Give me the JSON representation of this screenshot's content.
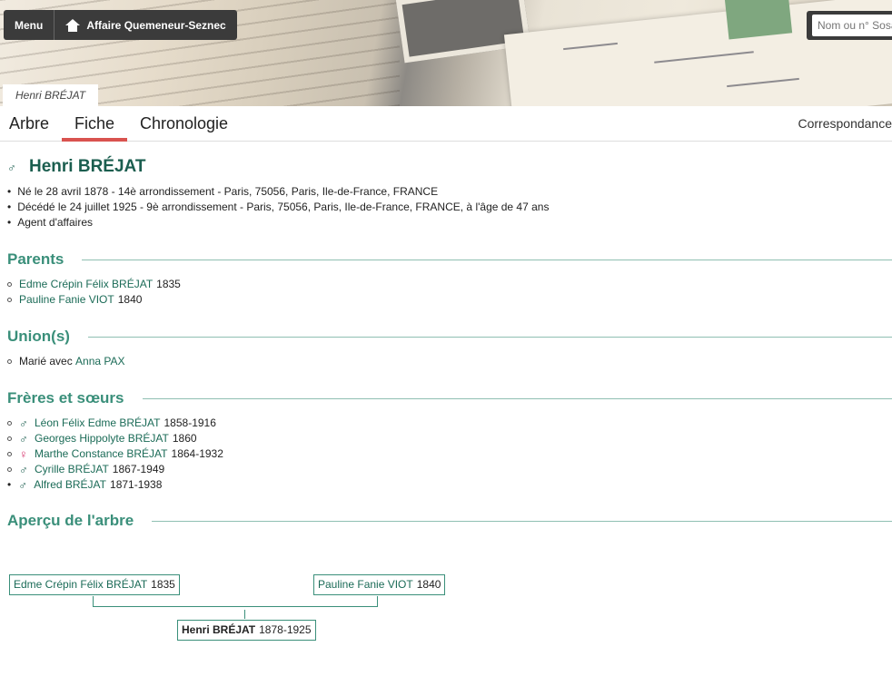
{
  "topbar": {
    "menu_label": "Menu",
    "site_label": "Affaire Quemeneur-Seznec"
  },
  "search": {
    "placeholder": "Nom ou n° Sosa"
  },
  "breadcrumb": "Henri BRÉJAT",
  "tabs": [
    {
      "label": "Arbre"
    },
    {
      "label": "Fiche",
      "active": true
    },
    {
      "label": "Chronologie"
    }
  ],
  "tab_right": "Correspondance",
  "person": {
    "name": "Henri BRÉJAT",
    "sex": "male",
    "facts": [
      "Né le 28 avril 1878 - 14è arrondissement - Paris, 75056, Paris, Ile-de-France, FRANCE",
      "Décédé le 24 juillet 1925 - 9è arrondissement - Paris, 75056, Paris, Ile-de-France, FRANCE, à l'âge de 47 ans",
      "Agent d'affaires"
    ]
  },
  "sections": {
    "parents": {
      "title": "Parents",
      "items": [
        {
          "name": "Edme Crépin Félix BRÉJAT",
          "years": "1835"
        },
        {
          "name": "Pauline Fanie VIOT",
          "years": "1840"
        }
      ]
    },
    "unions": {
      "title": "Union(s)",
      "items": [
        {
          "prefix": "Marié avec",
          "name": "Anna PAX"
        }
      ]
    },
    "siblings": {
      "title": "Frères et sœurs",
      "items": [
        {
          "sex": "male",
          "name": "Léon Félix Edme BRÉJAT",
          "years": "1858-1916"
        },
        {
          "sex": "male",
          "name": "Georges Hippolyte BRÉJAT",
          "years": "1860"
        },
        {
          "sex": "female",
          "name": "Marthe Constance BRÉJAT",
          "years": "1864-1932"
        },
        {
          "sex": "male",
          "name": "Cyrille BRÉJAT",
          "years": "1867-1949"
        },
        {
          "sex": "male",
          "name": "Alfred BRÉJAT",
          "years": "1871-1938"
        }
      ]
    },
    "tree": {
      "title": "Aperçu de l'arbre",
      "father": {
        "name": "Edme Crépin Félix BRÉJAT",
        "years": "1835"
      },
      "mother": {
        "name": "Pauline Fanie VIOT",
        "years": "1840"
      },
      "self": {
        "name": "Henri BRÉJAT",
        "years": "1878-1925"
      }
    }
  },
  "icons": {
    "male": "♂",
    "female": "♀",
    "home": "home-icon"
  },
  "colors": {
    "accent_green": "#1b5e4f",
    "section_green": "#3a8f7a",
    "tab_underline": "#d9534f",
    "female": "#d6336c"
  }
}
